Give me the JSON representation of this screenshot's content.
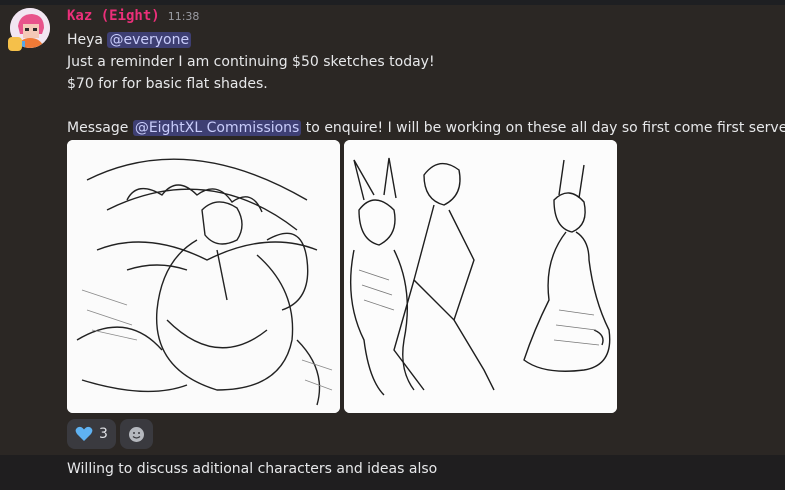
{
  "message": {
    "author": "Kaz (Eight)",
    "timestamp": "11:38",
    "lines": {
      "l1_prefix": "Heya ",
      "l1_mention": "@everyone",
      "l2": "Just a reminder I am continuing $50 sketches today!",
      "l3": "$70 for for basic flat shades.",
      "l5_prefix": "Message ",
      "l5_mention": "@EightXL Commissions",
      "l5_suffix": " to enquire! I will be working on these all day so first come first serve"
    },
    "images": [
      {
        "icon": "sketch-image"
      },
      {
        "icon": "sketch-image"
      }
    ],
    "reactions": [
      {
        "icon": "blue-heart-icon",
        "count": "3"
      },
      {
        "icon": "add-reaction-smiley-icon"
      }
    ]
  },
  "message2": {
    "text": "Willing to discuss aditional characters and ideas also"
  },
  "colors": {
    "background": "#2b2724",
    "username": "#ec2f7a",
    "mention_bg": "#3e3f73",
    "mention_text": "#c9cdfb"
  }
}
